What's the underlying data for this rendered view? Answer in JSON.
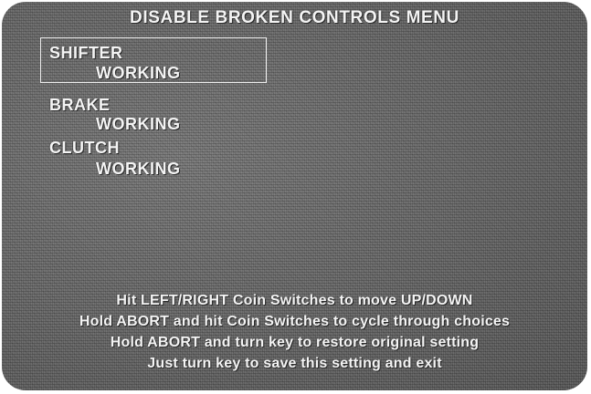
{
  "menu": {
    "title": "DISABLE BROKEN CONTROLS MENU",
    "items": [
      {
        "label": "SHIFTER",
        "status": "WORKING",
        "selected": true
      },
      {
        "label": "BRAKE",
        "status": "WORKING",
        "selected": false
      },
      {
        "label": "CLUTCH",
        "status": "WORKING",
        "selected": false
      }
    ]
  },
  "instructions": [
    "Hit LEFT/RIGHT Coin Switches to move UP/DOWN",
    "Hold ABORT and hit Coin Switches to cycle through choices",
    "Hold ABORT and turn key to restore original setting",
    "Just turn key to save this setting and exit"
  ],
  "colors": {
    "screen_background": "#6b6b6b",
    "text": "#f4f4f4",
    "selection_border": "#efefef"
  }
}
